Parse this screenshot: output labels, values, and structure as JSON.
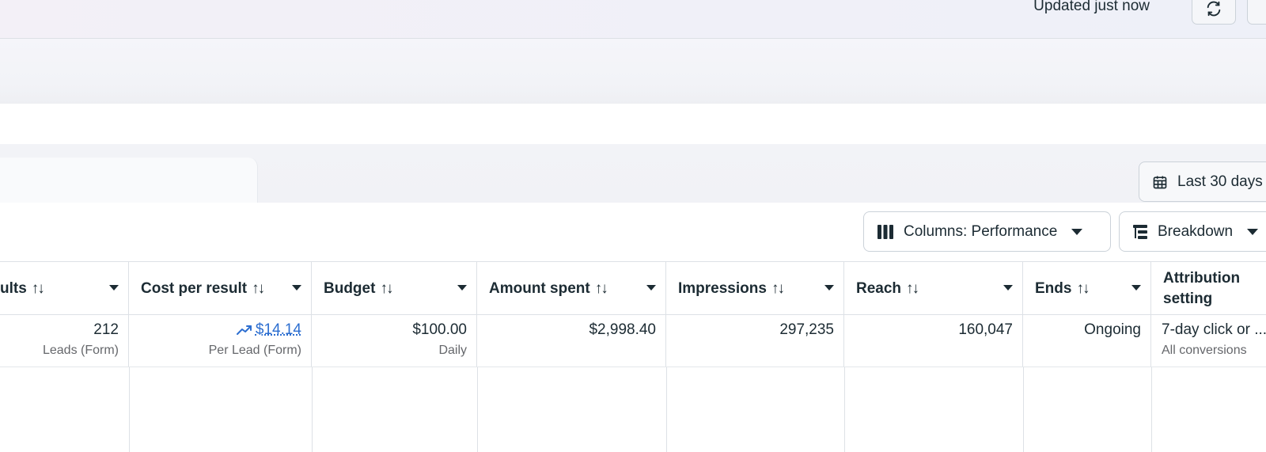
{
  "header": {
    "updated_text": "Updated just now"
  },
  "date_range": {
    "label": "Last 30 days"
  },
  "toolbar": {
    "columns_label": "Columns: Performance",
    "breakdown_label": "Breakdown"
  },
  "table": {
    "columns": [
      {
        "label": "ults",
        "sort": "↑↓"
      },
      {
        "label": "Cost per result",
        "sort": "↑↓"
      },
      {
        "label": "Budget",
        "sort": "↑↓"
      },
      {
        "label": "Amount spent",
        "sort": "↑↓"
      },
      {
        "label": "Impressions",
        "sort": "↑↓"
      },
      {
        "label": "Reach",
        "sort": "↑↓"
      },
      {
        "label": "Ends",
        "sort": "↑↓"
      },
      {
        "label": "Attribution setting"
      }
    ],
    "row": {
      "results": {
        "value": "212",
        "sub": "Leads (Form)"
      },
      "cost_per_result": {
        "value": "$14.14",
        "sub": "Per Lead (Form)"
      },
      "budget": {
        "value": "$100.00",
        "sub": "Daily"
      },
      "amount_spent": {
        "value": "$2,998.40"
      },
      "impressions": {
        "value": "297,235"
      },
      "reach": {
        "value": "160,047"
      },
      "ends": {
        "value": "Ongoing"
      },
      "attribution": {
        "value": "7-day click or ...",
        "sub": "All conversions"
      }
    }
  },
  "colors": {
    "link": "#2c6ed0",
    "text": "#1c2b33",
    "muted": "#65676b",
    "border": "#dde1e6"
  },
  "icons": {
    "refresh": "refresh-icon",
    "calendar": "calendar-icon",
    "columns": "columns-icon",
    "breakdown": "breakdown-icon",
    "trend": "trend-up-icon"
  }
}
